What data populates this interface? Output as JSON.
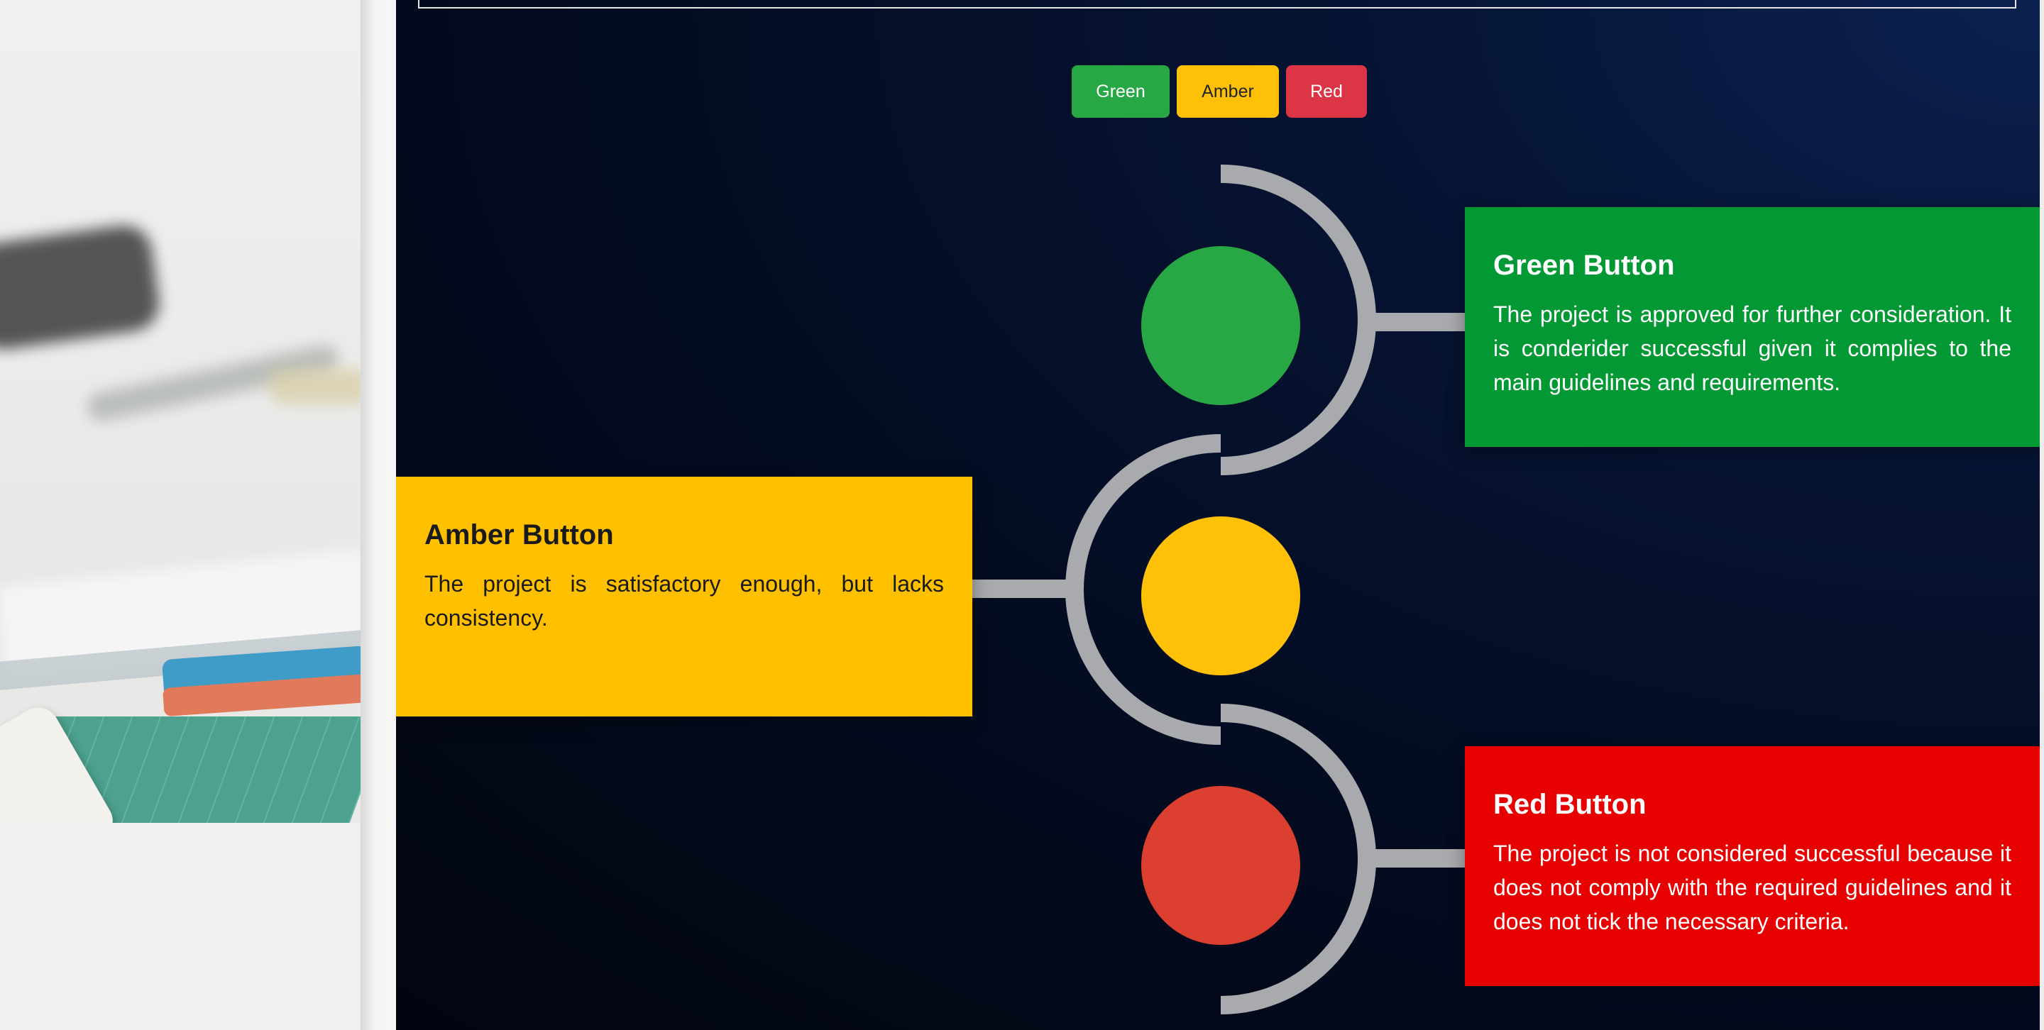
{
  "buttons": {
    "green": "Green",
    "amber": "Amber",
    "red": "Red"
  },
  "cards": {
    "green": {
      "title": "Green Button",
      "text": "The project is approved for further consideration. It is conderider successful given it complies to the main guidelines and requirements."
    },
    "amber": {
      "title": "Amber Button",
      "text": "The project is satisfactory enough, but lacks consistency."
    },
    "red": {
      "title": "Red Button",
      "text": "The project is not considered successful because it does not comply with the required guidelines and it does not tick the necessary criteria."
    }
  },
  "colors": {
    "green_light": "#28a745",
    "amber_light": "#ffc107",
    "red_light": "#dc3f30",
    "track": "#a9aaad",
    "panel_bg": "#040c22"
  }
}
